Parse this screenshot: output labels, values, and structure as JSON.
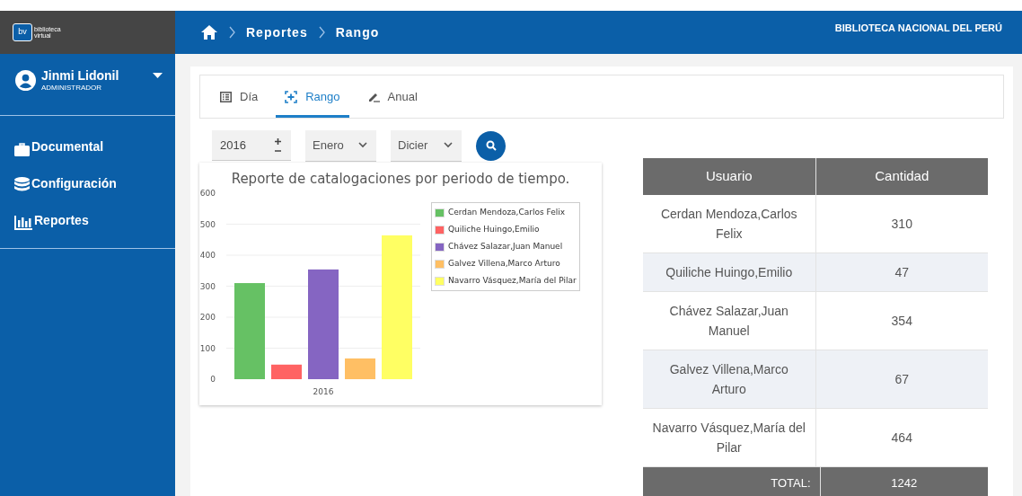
{
  "header": {
    "logo_text": "biblioteca virtual",
    "logo_mark": "bv",
    "breadcrumb": [
      "Reportes",
      "Rango"
    ],
    "org": "BIBLIOTECA NACIONAL DEL PERÚ"
  },
  "user": {
    "name": "Jinmi Lidonil",
    "role": "ADMINISTRADOR"
  },
  "sidebar": {
    "items": [
      {
        "label": "Documental",
        "kind": "briefcase"
      },
      {
        "label": "Configuración",
        "kind": "database"
      },
      {
        "label": "Reportes",
        "kind": "chart"
      }
    ]
  },
  "tabs": [
    {
      "label": "Día",
      "kind": "list",
      "selected": false
    },
    {
      "label": "Rango",
      "kind": "plus",
      "selected": true
    },
    {
      "label": "Anual",
      "kind": "pen",
      "selected": false
    }
  ],
  "filters": {
    "year": "2016",
    "from": "Enero",
    "to": "Dicier"
  },
  "chart_data": {
    "type": "bar",
    "grid": true,
    "legend": true,
    "title": "Reporte de catalogaciones por periodo de tiempo.",
    "categories": [
      "2016"
    ],
    "ylim": [
      0,
      600
    ],
    "yticks": [
      0,
      100,
      200,
      300,
      400,
      500,
      600
    ],
    "series": [
      {
        "name": "Cerdan Mendoza,Carlos Felix",
        "color": "#66c164",
        "values": [
          310
        ]
      },
      {
        "name": "Quiliche Huingo,Emilio",
        "color": "#ff6363",
        "values": [
          47
        ]
      },
      {
        "name": "Chávez Salazar,Juan Manuel",
        "color": "#8565c2",
        "values": [
          354
        ]
      },
      {
        "name": "Galvez Villena,Marco Arturo",
        "color": "#ffbf64",
        "values": [
          67
        ]
      },
      {
        "name": "Navarro Vásquez,María del Pilar",
        "color": "#ffff63",
        "values": [
          464
        ]
      }
    ]
  },
  "table": {
    "columns": [
      "Usuario",
      "Cantidad"
    ],
    "rows": [
      [
        "Cerdan Mendoza,Carlos Felix",
        "310"
      ],
      [
        "Quiliche Huingo,Emilio",
        "47"
      ],
      [
        "Chávez Salazar,Juan Manuel",
        "354"
      ],
      [
        "Galvez Villena,Marco Arturo",
        "67"
      ],
      [
        "Navarro Vásquez,María del Pilar",
        "464"
      ]
    ],
    "total_label": "TOTAL:",
    "total": "1242"
  }
}
